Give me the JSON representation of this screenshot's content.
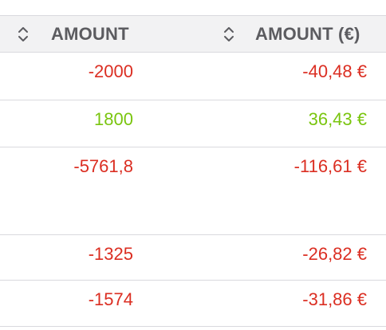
{
  "header": {
    "amount_label": "AMOUNT",
    "amount_eur_label": "AMOUNT (€)",
    "sort_icon": "sort-up-down-icon"
  },
  "rows": [
    {
      "amount": "-2000",
      "amount_eur": "-40,48 €",
      "status": "negative"
    },
    {
      "amount": "1800",
      "amount_eur": "36,43 €",
      "status": "positive"
    },
    {
      "amount": "-5761,8",
      "amount_eur": "-116,61 €",
      "status": "negative"
    },
    {
      "amount": "-1325",
      "amount_eur": "-26,82 €",
      "status": "negative"
    },
    {
      "amount": "-1574",
      "amount_eur": "-31,86 €",
      "status": "negative"
    }
  ],
  "colors": {
    "negative": "#db2e22",
    "positive": "#7ac50f",
    "header_text": "#5c5c60",
    "header_bg": "#f2f2f3",
    "border": "#d9d9de"
  }
}
